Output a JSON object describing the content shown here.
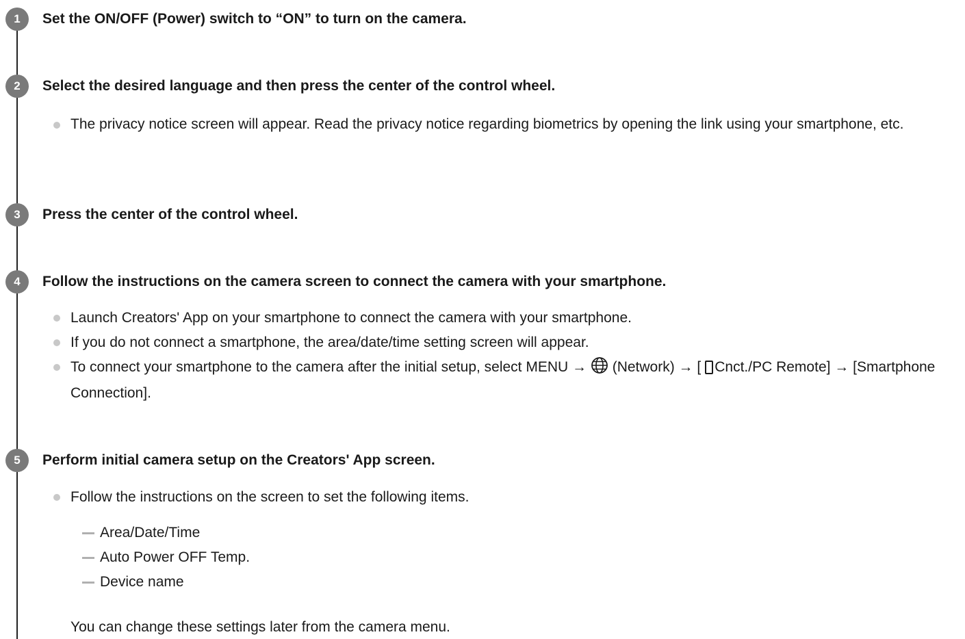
{
  "steps": [
    {
      "number": "1",
      "title": "Set the ON/OFF (Power) switch to “ON” to turn on the camera."
    },
    {
      "number": "2",
      "title": "Select the desired language and then press the center of the control wheel.",
      "bullets": [
        "The privacy notice screen will appear. Read the privacy notice regarding biometrics by opening the link using your smartphone, etc."
      ]
    },
    {
      "number": "3",
      "title": "Press the center of the control wheel."
    },
    {
      "number": "4",
      "title": "Follow the instructions on the camera screen to connect the camera with your smartphone.",
      "bullets": [
        "Launch Creators' App on your smartphone to connect the camera with your smartphone.",
        "If you do not connect a smartphone, the area/date/time setting screen will appear."
      ],
      "menu_bullet": {
        "before_icon": "To connect your smartphone to the camera after the initial setup, select MENU →",
        "network_icon": "globe-icon",
        "after_icon": "(Network) → [",
        "phone_icon": "smartphone-icon",
        "after_phone": "Cnct./PC Remote] → [Smartphone Connection]."
      }
    },
    {
      "number": "5",
      "title": "Perform initial camera setup on the Creators' App screen.",
      "bullets": [
        "Follow the instructions on the screen to set the following items."
      ],
      "sub_items": [
        "Area/Date/Time",
        "Auto Power OFF Temp.",
        "Device name"
      ],
      "note": "You can change these settings later from the camera menu."
    }
  ]
}
